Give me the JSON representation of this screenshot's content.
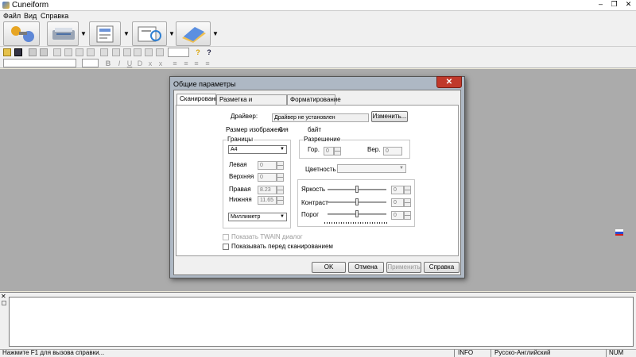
{
  "app": {
    "title": "Cuneiform"
  },
  "window_controls": {
    "minimize": "–",
    "maximize": "❐",
    "close": "✕"
  },
  "menu": {
    "items": [
      "Файл",
      "Вид",
      "Справка"
    ]
  },
  "dialog": {
    "title": "Общие параметры",
    "close": "✕",
    "tabs": [
      "Сканирование",
      "Разметка и распознавание",
      "Форматирование"
    ],
    "driver_label": "Драйвер:",
    "driver_value": "Драйвер не установлен",
    "change_button": "Изменить...",
    "image_size_label": "Размер изображения",
    "image_size_value": "0",
    "image_size_unit": "байт",
    "borders": {
      "group_label": "Границы",
      "paper": "A4",
      "left_label": "Левая",
      "left_value": "0",
      "top_label": "Верхняя",
      "top_value": "0",
      "right_label": "Правая",
      "right_value": "8.23",
      "bottom_label": "Нижняя",
      "bottom_value": "11.65",
      "unit": "Миллиметр"
    },
    "resolution": {
      "group_label": "Разрешение",
      "hor_label": "Гор.",
      "hor_value": "0",
      "ver_label": "Вер.",
      "ver_value": "0"
    },
    "color_label": "Цветность",
    "brightness_label": "Яркость",
    "brightness_value": "0",
    "contrast_label": "Контраст",
    "contrast_value": "0",
    "threshold_label": "Порог",
    "threshold_value": "0",
    "show_twain_label": "Показать TWAIN диалог",
    "show_before_scan_label": "Показывать перед сканированием",
    "ok": "OK",
    "cancel": "Отмена",
    "apply": "Применить",
    "help": "Справка"
  },
  "statusbar": {
    "hint": "Нажмите F1 для вызова справки...",
    "info": "INFO",
    "language": "Русско-Английский",
    "num": "NUM"
  },
  "bottom_panel": {
    "close": "✕"
  }
}
